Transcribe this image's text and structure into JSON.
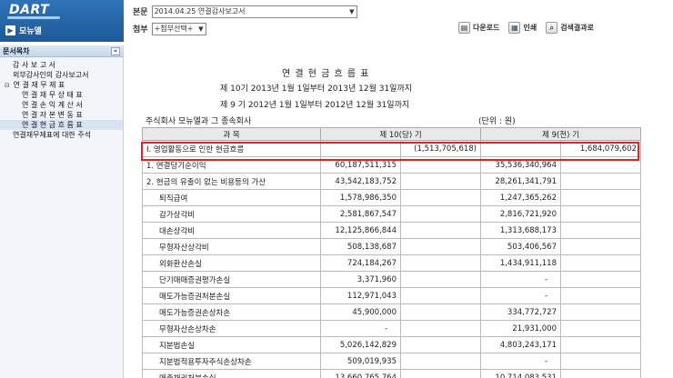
{
  "header": {
    "logo": "DART",
    "nav_label": "모뉴엘",
    "main_doc_label": "본문",
    "main_doc_value": "2014.04.25  연결감사보고서",
    "attach_label": "첨부",
    "attach_value": "+첨부선택+",
    "tools": [
      {
        "icon": "download-icon",
        "label": "다운로드"
      },
      {
        "icon": "print-icon",
        "label": "인쇄"
      },
      {
        "icon": "search-icon",
        "label": "검색결과로"
      }
    ]
  },
  "sidebar": {
    "title": "문서목차",
    "collapse_label": "«",
    "items": [
      {
        "label": "감 사 보 고 서",
        "toggle": "",
        "level": 1
      },
      {
        "label": "외부감사인의 감사보고서",
        "toggle": "",
        "level": 1
      },
      {
        "label": "연 결 재 무 제 표",
        "toggle": "⊟",
        "level": 1
      },
      {
        "label": "연 결 재 무 상 태 표",
        "toggle": "",
        "level": 2
      },
      {
        "label": "연 결 손 익 계 산 서",
        "toggle": "",
        "level": 2
      },
      {
        "label": "연 결 자 본 변 동 표",
        "toggle": "",
        "level": 2
      },
      {
        "label": "연 결 현 금 흐 름 표",
        "toggle": "",
        "level": 2
      },
      {
        "label": "연결재무제표에 대한 주석",
        "toggle": "",
        "level": 1
      }
    ]
  },
  "document": {
    "title": "연 결 현 금 흐 름 표",
    "period_current": "제 10기 2013년 1월 1일부터 2013년 12월 31일까지",
    "period_prior": "제 9 기 2012년 1월 1일부터 2012년 12월 31일까지",
    "company": "주식회사 모뉴엘과 그 종속회사",
    "unit": "(단위 : 원)",
    "columns": [
      "과       목",
      "제 10(당) 기",
      "제 9(전) 기"
    ],
    "rows": [
      {
        "label": "Ⅰ. 영업활동으로 인한 현금흐름",
        "c1": "",
        "c2": "(1,513,705,618)",
        "p1": "",
        "p2": "1,684,079,602",
        "indent": 1
      },
      {
        "label": "1. 연결당기순이익",
        "c1": "60,187,511,315",
        "c2": "",
        "p1": "35,536,340,964",
        "p2": "",
        "indent": 1
      },
      {
        "label": "2. 현금의 유출이 없는 비용등의  가산",
        "c1": "43,542,183,752",
        "c2": "",
        "p1": "28,261,341,791",
        "p2": "",
        "indent": 1
      },
      {
        "label": "퇴직급여",
        "c1": "1,578,986,350",
        "c2": "",
        "p1": "1,247,365,262",
        "p2": "",
        "indent": 2
      },
      {
        "label": "감가상각비",
        "c1": "2,581,867,547",
        "c2": "",
        "p1": "2,816,721,920",
        "p2": "",
        "indent": 2
      },
      {
        "label": "대손상각비",
        "c1": "12,125,866,844",
        "c2": "",
        "p1": "1,313,688,173",
        "p2": "",
        "indent": 2
      },
      {
        "label": "무형자산상각비",
        "c1": "508,138,687",
        "c2": "",
        "p1": "503,406,567",
        "p2": "",
        "indent": 2
      },
      {
        "label": "외화환산손실",
        "c1": "724,184,267",
        "c2": "",
        "p1": "1,434,911,118",
        "p2": "",
        "indent": 2
      },
      {
        "label": "단기매매증권평가손실",
        "c1": "3,371,960",
        "c2": "",
        "p1": "-",
        "p2": "",
        "indent": 2
      },
      {
        "label": "매도가능증권처분손실",
        "c1": "112,971,043",
        "c2": "",
        "p1": "-",
        "p2": "",
        "indent": 2
      },
      {
        "label": "매도가능증권손상차손",
        "c1": "45,900,000",
        "c2": "",
        "p1": "334,772,727",
        "p2": "",
        "indent": 2
      },
      {
        "label": "무형자산손상차손",
        "c1": "-",
        "c2": "",
        "p1": "21,931,000",
        "p2": "",
        "indent": 2
      },
      {
        "label": "지분법손실",
        "c1": "5,026,142,829",
        "c2": "",
        "p1": "4,803,243,171",
        "p2": "",
        "indent": 2
      },
      {
        "label": "지분법적용투자주식손상차손",
        "c1": "509,019,935",
        "c2": "",
        "p1": "-",
        "p2": "",
        "indent": 2
      },
      {
        "label": "매출채권처분손실",
        "c1": "13,660,765,764",
        "c2": "",
        "p1": "10,714,083,531",
        "p2": "",
        "indent": 2
      }
    ]
  }
}
